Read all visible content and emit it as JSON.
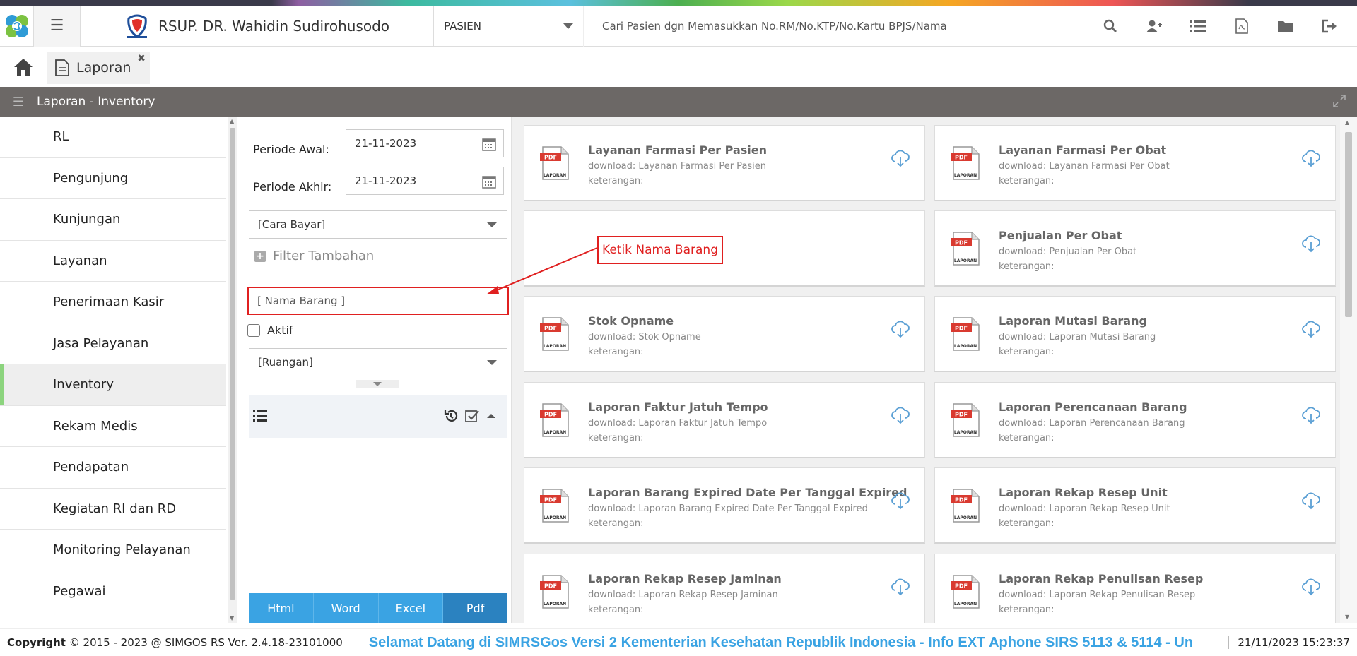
{
  "header": {
    "hospital_name": "RSUP. DR. Wahidin Sudirohusodo",
    "patient_type": "PASIEN",
    "search_placeholder": "Cari Pasien dgn Memasukkan No.RM/No.KTP/No.Kartu BPJS/Nama",
    "tools": [
      "search-icon",
      "add-user-icon",
      "list-icon",
      "pdf-file-icon",
      "folder-icon",
      "logout-icon"
    ]
  },
  "tabs": [
    {
      "label": "Laporan"
    }
  ],
  "section": {
    "title": "Laporan - Inventory"
  },
  "sidebar": {
    "items": [
      {
        "label": "RL"
      },
      {
        "label": "Pengunjung"
      },
      {
        "label": "Kunjungan"
      },
      {
        "label": "Layanan"
      },
      {
        "label": "Penerimaan Kasir"
      },
      {
        "label": "Jasa Pelayanan"
      },
      {
        "label": "Inventory"
      },
      {
        "label": "Rekam Medis"
      },
      {
        "label": "Pendapatan"
      },
      {
        "label": "Kegiatan RI dan RD"
      },
      {
        "label": "Monitoring Pelayanan"
      },
      {
        "label": "Pegawai"
      }
    ],
    "active": "Inventory"
  },
  "filter": {
    "periode_awal_label": "Periode Awal:",
    "periode_awal_value": "21-11-2023",
    "periode_akhir_label": "Periode Akhir:",
    "periode_akhir_value": "21-11-2023",
    "cara_bayar": "[Cara Bayar]",
    "filter_tambahan": "Filter Tambahan",
    "nama_barang_placeholder": "[ Nama Barang ]",
    "aktif_label": "Aktif",
    "ruangan": "[Ruangan]",
    "buttons": {
      "html": "Html",
      "word": "Word",
      "excel": "Excel",
      "pdf": "Pdf"
    }
  },
  "cards": [
    {
      "title": "Layanan Farmasi Per Pasien",
      "download": "download: Layanan Farmasi Per Pasien",
      "keterangan": "keterangan:"
    },
    {
      "title": "Layanan Farmasi Per Obat",
      "download": "download: Layanan Farmasi Per Obat",
      "keterangan": "keterangan:"
    },
    {
      "title": "",
      "download": "",
      "keterangan": ""
    },
    {
      "title": "Penjualan Per Obat",
      "download": "download: Penjualan Per Obat",
      "keterangan": "keterangan:"
    },
    {
      "title": "Stok Opname",
      "download": "download: Stok Opname",
      "keterangan": "keterangan:"
    },
    {
      "title": "Laporan Mutasi Barang",
      "download": "download: Laporan Mutasi Barang",
      "keterangan": "keterangan:"
    },
    {
      "title": "Laporan Faktur Jatuh Tempo",
      "download": "download: Laporan Faktur Jatuh Tempo",
      "keterangan": "keterangan:"
    },
    {
      "title": "Laporan Perencanaan Barang",
      "download": "download: Laporan Perencanaan Barang",
      "keterangan": "keterangan:"
    },
    {
      "title": "Laporan Barang Expired Date Per Tanggal Expired",
      "download": "download: Laporan Barang Expired Date Per Tanggal Expired",
      "keterangan": "keterangan:"
    },
    {
      "title": "Laporan Rekap Resep Unit",
      "download": "download: Laporan Rekap Resep Unit",
      "keterangan": "keterangan:"
    },
    {
      "title": "Laporan Rekap Resep Jaminan",
      "download": "download: Laporan Rekap Resep Jaminan",
      "keterangan": "keterangan:"
    },
    {
      "title": "Laporan Rekap Penulisan Resep",
      "download": "download: Laporan Rekap Penulisan Resep",
      "keterangan": "keterangan:"
    }
  ],
  "pdf_icon_label": "LAPORAN",
  "annotation": {
    "text": "Ketik Nama Barang",
    "color": "#e02020"
  },
  "footer": {
    "copyright_label": "Copyright",
    "copyright_text": "2015 - 2023 @ SIMGOS RS Ver. 2.4.18-23101000",
    "marquee": "Selamat Datang di SIMRSGos Versi 2 Kementerian Kesehatan Republik Indonesia - Info EXT Aphone SIRS 5113 & 5114 - Un",
    "datetime": "21/11/2023 15:23:37"
  },
  "colors": {
    "accent": "#3aa3e3",
    "pdf_button": "#2b82c0",
    "section_bar": "#6c6866",
    "active_marker": "#8cd47e",
    "annotation": "#e02020"
  }
}
